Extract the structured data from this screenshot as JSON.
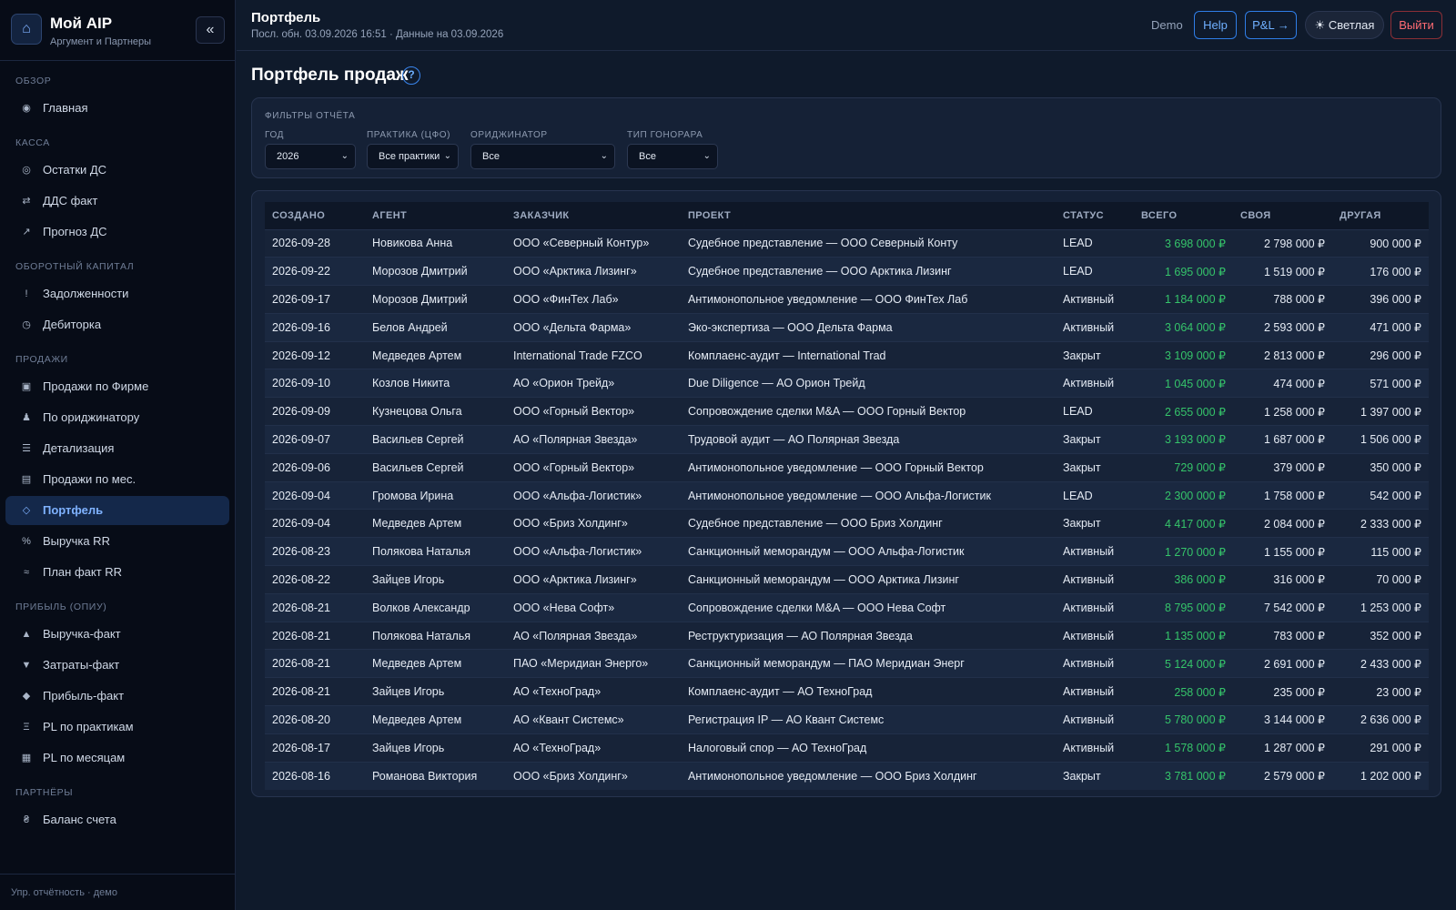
{
  "brand": {
    "title": "Мой AIP",
    "subtitle": "Аргумент и Партнеры",
    "logo_icon": "home-icon",
    "collapse_label": "«"
  },
  "nav": {
    "sections": [
      {
        "title": "ОБЗОР",
        "items": [
          {
            "icon": "◉",
            "label": "Главная"
          }
        ]
      },
      {
        "title": "КАССА",
        "items": [
          {
            "icon": "◎",
            "label": "Остатки ДС"
          },
          {
            "icon": "⇄",
            "label": "ДДС факт"
          },
          {
            "icon": "↗",
            "label": "Прогноз ДС"
          }
        ]
      },
      {
        "title": "ОБОРОТНЫЙ КАПИТАЛ",
        "items": [
          {
            "icon": "!",
            "label": "Задолженности"
          },
          {
            "icon": "◷",
            "label": "Дебиторка"
          }
        ]
      },
      {
        "title": "ПРОДАЖИ",
        "items": [
          {
            "icon": "▣",
            "label": "Продажи по Фирме"
          },
          {
            "icon": "♟",
            "label": "По ориджинатору"
          },
          {
            "icon": "☰",
            "label": "Детализация"
          },
          {
            "icon": "▤",
            "label": "Продажи по мес."
          },
          {
            "icon": "◇",
            "label": "Портфель",
            "active": true
          },
          {
            "icon": "%",
            "label": "Выручка RR"
          },
          {
            "icon": "≈",
            "label": "План факт RR"
          }
        ]
      },
      {
        "title": "ПРИБЫЛЬ (ОПИУ)",
        "items": [
          {
            "icon": "▲",
            "label": "Выручка-факт"
          },
          {
            "icon": "▼",
            "label": "Затраты-факт"
          },
          {
            "icon": "◆",
            "label": "Прибыль-факт"
          },
          {
            "icon": "Ξ",
            "label": "PL по практикам"
          },
          {
            "icon": "▦",
            "label": "PL по месяцам"
          }
        ]
      },
      {
        "title": "ПАРТНЁРЫ",
        "items": [
          {
            "icon": "₴",
            "label": "Баланс счета"
          }
        ]
      }
    ],
    "footer": "Упр. отчётность · демо"
  },
  "topbar": {
    "title": "Портфель",
    "subtitle": "Посл. обн. 03.09.2026 16:51 · Данные на 03.09.2026",
    "demo": "Demo",
    "help": "Help",
    "pl": "P&L →",
    "theme": "☀ Светлая",
    "logout": "Выйти"
  },
  "page": {
    "title": "Портфель продаж",
    "help_icon": "?"
  },
  "filters": {
    "heading": "ФИЛЬТРЫ ОТЧЁТА",
    "year": {
      "label": "ГОД",
      "value": "2026"
    },
    "practice": {
      "label": "ПРАКТИКА (ЦФО)",
      "value": "Все практики"
    },
    "originator": {
      "label": "ОРИДЖИНАТОР",
      "value": "Все"
    },
    "fee": {
      "label": "ТИП ГОНОРАРА",
      "value": "Все"
    }
  },
  "table": {
    "headers": [
      "СОЗДАНО",
      "АГЕНТ",
      "ЗАКАЗЧИК",
      "ПРОЕКТ",
      "СТАТУС",
      "ВСЕГО",
      "СВОЯ",
      "ДРУГАЯ"
    ],
    "rows": [
      [
        "2026-09-28",
        "Новикова Анна",
        "ООО «Северный Контур»",
        "Судебное представление — ООО Северный Конту",
        "LEAD",
        "3 698 000 ₽",
        "2 798 000 ₽",
        "900 000 ₽"
      ],
      [
        "2026-09-22",
        "Морозов Дмитрий",
        "ООО «Арктика Лизинг»",
        "Судебное представление — ООО Арктика Лизинг",
        "LEAD",
        "1 695 000 ₽",
        "1 519 000 ₽",
        "176 000 ₽"
      ],
      [
        "2026-09-17",
        "Морозов Дмитрий",
        "ООО «ФинТех Лаб»",
        "Антимонопольное уведомление — ООО ФинТех Лаб",
        "Активный",
        "1 184 000 ₽",
        "788 000 ₽",
        "396 000 ₽"
      ],
      [
        "2026-09-16",
        "Белов Андрей",
        "ООО «Дельта Фарма»",
        "Эко-экспертиза — ООО Дельта Фарма",
        "Активный",
        "3 064 000 ₽",
        "2 593 000 ₽",
        "471 000 ₽"
      ],
      [
        "2026-09-12",
        "Медведев Артем",
        "International Trade FZCO",
        "Комплаенс-аудит — International Trad",
        "Закрыт",
        "3 109 000 ₽",
        "2 813 000 ₽",
        "296 000 ₽"
      ],
      [
        "2026-09-10",
        "Козлов Никита",
        "АО «Орион Трейд»",
        "Due Diligence — АО Орион Трейд",
        "Активный",
        "1 045 000 ₽",
        "474 000 ₽",
        "571 000 ₽"
      ],
      [
        "2026-09-09",
        "Кузнецова Ольга",
        "ООО «Горный Вектор»",
        "Сопровождение сделки M&A — ООО Горный Вектор",
        "LEAD",
        "2 655 000 ₽",
        "1 258 000 ₽",
        "1 397 000 ₽"
      ],
      [
        "2026-09-07",
        "Васильев Сергей",
        "АО «Полярная Звезда»",
        "Трудовой аудит — АО Полярная Звезда",
        "Закрыт",
        "3 193 000 ₽",
        "1 687 000 ₽",
        "1 506 000 ₽"
      ],
      [
        "2026-09-06",
        "Васильев Сергей",
        "ООО «Горный Вектор»",
        "Антимонопольное уведомление — ООО Горный Вектор",
        "Закрыт",
        "729 000 ₽",
        "379 000 ₽",
        "350 000 ₽"
      ],
      [
        "2026-09-04",
        "Громова Ирина",
        "ООО «Альфа-Логистик»",
        "Антимонопольное уведомление — ООО Альфа-Логистик",
        "LEAD",
        "2 300 000 ₽",
        "1 758 000 ₽",
        "542 000 ₽"
      ],
      [
        "2026-09-04",
        "Медведев Артем",
        "ООО «Бриз Холдинг»",
        "Судебное представление — ООО Бриз Холдинг",
        "Закрыт",
        "4 417 000 ₽",
        "2 084 000 ₽",
        "2 333 000 ₽"
      ],
      [
        "2026-08-23",
        "Полякова Наталья",
        "ООО «Альфа-Логистик»",
        "Санкционный меморандум — ООО Альфа-Логистик",
        "Активный",
        "1 270 000 ₽",
        "1 155 000 ₽",
        "115 000 ₽"
      ],
      [
        "2026-08-22",
        "Зайцев Игорь",
        "ООО «Арктика Лизинг»",
        "Санкционный меморандум — ООО Арктика Лизинг",
        "Активный",
        "386 000 ₽",
        "316 000 ₽",
        "70 000 ₽"
      ],
      [
        "2026-08-21",
        "Волков Александр",
        "ООО «Нева Софт»",
        "Сопровождение сделки M&A — ООО Нева Софт",
        "Активный",
        "8 795 000 ₽",
        "7 542 000 ₽",
        "1 253 000 ₽"
      ],
      [
        "2026-08-21",
        "Полякова Наталья",
        "АО «Полярная Звезда»",
        "Реструктуризация — АО Полярная Звезда",
        "Активный",
        "1 135 000 ₽",
        "783 000 ₽",
        "352 000 ₽"
      ],
      [
        "2026-08-21",
        "Медведев Артем",
        "ПАО «Меридиан Энерго»",
        "Санкционный меморандум — ПАО Меридиан Энерг",
        "Активный",
        "5 124 000 ₽",
        "2 691 000 ₽",
        "2 433 000 ₽"
      ],
      [
        "2026-08-21",
        "Зайцев Игорь",
        "АО «ТехноГрад»",
        "Комплаенс-аудит — АО ТехноГрад",
        "Активный",
        "258 000 ₽",
        "235 000 ₽",
        "23 000 ₽"
      ],
      [
        "2026-08-20",
        "Медведев Артем",
        "АО «Квант Системс»",
        "Регистрация IP — АО Квант Системс",
        "Активный",
        "5 780 000 ₽",
        "3 144 000 ₽",
        "2 636 000 ₽"
      ],
      [
        "2026-08-17",
        "Зайцев Игорь",
        "АО «ТехноГрад»",
        "Налоговый спор — АО ТехноГрад",
        "Активный",
        "1 578 000 ₽",
        "1 287 000 ₽",
        "291 000 ₽"
      ],
      [
        "2026-08-16",
        "Романова Виктория",
        "ООО «Бриз Холдинг»",
        "Антимонопольное уведомление — ООО Бриз Холдинг",
        "Закрыт",
        "3 781 000 ₽",
        "2 579 000 ₽",
        "1 202 000 ₽"
      ]
    ]
  },
  "colors": {
    "accent": "#7fb2ff",
    "positive": "#35c46a",
    "danger": "#ff6b73",
    "bg": "#0f1a2b",
    "sidebar": "#070c17"
  }
}
